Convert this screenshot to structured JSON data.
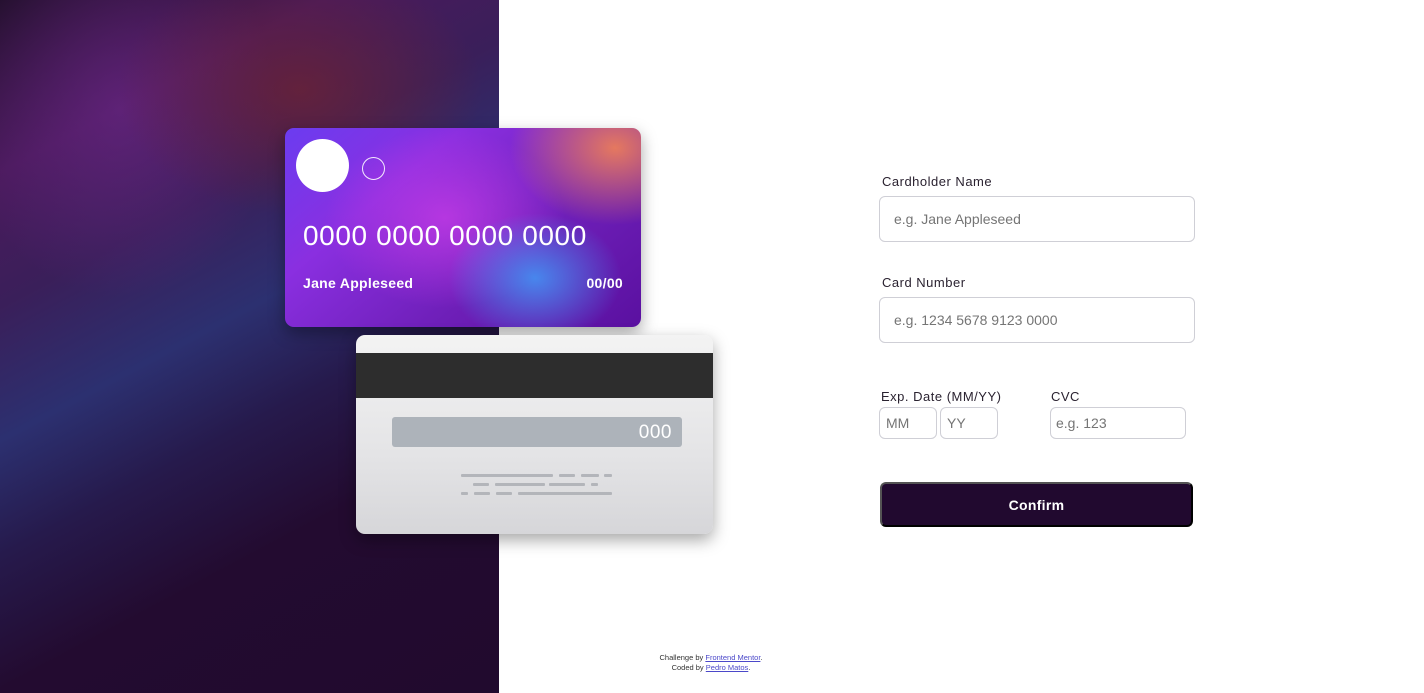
{
  "card_front": {
    "number": "0000 0000 0000 0000",
    "name": "Jane Appleseed",
    "expiry": "00/00"
  },
  "card_back": {
    "cvc": "000"
  },
  "form": {
    "name_label": "Cardholder Name",
    "name_placeholder": "e.g. Jane Appleseed",
    "number_label": "Card Number",
    "number_placeholder": "e.g. 1234 5678 9123 0000",
    "exp_label": "Exp. Date (MM/YY)",
    "month_placeholder": "MM",
    "year_placeholder": "YY",
    "cvc_label": "CVC",
    "cvc_placeholder": "e.g. 123",
    "confirm_label": "Confirm"
  },
  "attribution": {
    "challenge_prefix": "Challenge by ",
    "challenge_link": "Frontend Mentor",
    "challenge_suffix": ".",
    "coded_prefix": "Coded by ",
    "coded_link": "Pedro Matos",
    "coded_suffix": "."
  }
}
